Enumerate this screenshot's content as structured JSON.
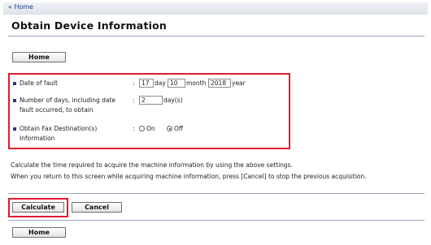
{
  "breadcrumb": {
    "home_link": "« Home"
  },
  "page": {
    "title": "Obtain Device Information"
  },
  "buttons": {
    "home_top": "Home",
    "calculate": "Calculate",
    "cancel": "Cancel",
    "home_bottom": "Home"
  },
  "form": {
    "date_of_fault": {
      "label": "Date of fault",
      "day_value": "17",
      "day_unit": "day",
      "month_value": "10",
      "month_unit": "month",
      "year_value": "2018",
      "year_unit": "year"
    },
    "num_days": {
      "label_line1": "Number of days, including date",
      "label_line2": "fault occurred, to obtain",
      "value": "2",
      "unit": "day(s)"
    },
    "fax_destination": {
      "label_line1": "Obtain Fax Destination(s)",
      "label_line2": "Information",
      "on_label": "On",
      "off_label": "Off",
      "selected": "Off"
    },
    "colon": ":"
  },
  "notes": {
    "line1": "Calculate the time required to acquire the machine information by using the above settings.",
    "line2": "When you return to this screen while acquiring machine information, press [Cancel] to stop the previous acquisition."
  },
  "colors": {
    "highlight": "#e21b2f",
    "bullet": "#1f3a8a",
    "link": "#1b3f8c"
  }
}
